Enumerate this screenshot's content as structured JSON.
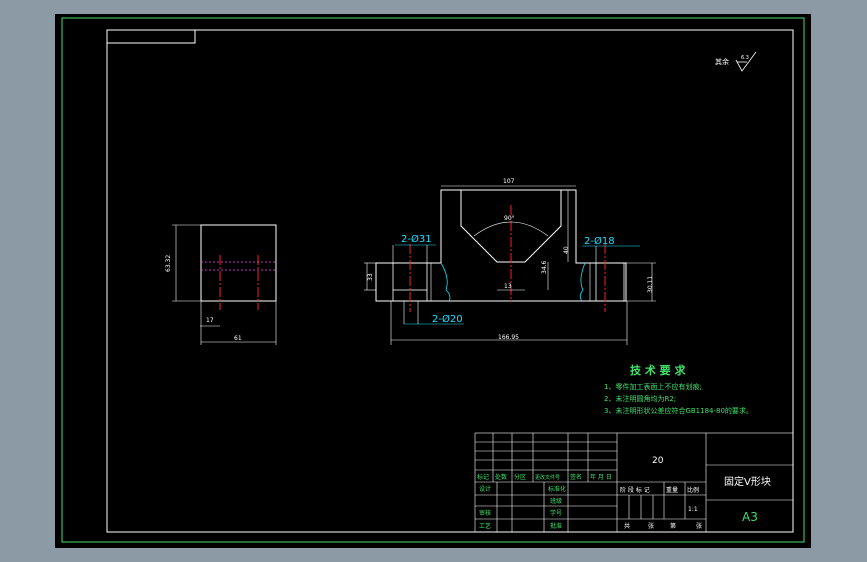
{
  "colors": {
    "background": "#000000",
    "frame": "#ffffff",
    "outer_frame": "#3fe06a",
    "geometry": "#ffffff",
    "dimension": "#00ff66",
    "centerline": "#ff2020",
    "hidden": "#ff44ff",
    "cyan": "#18e0ff"
  },
  "surface_roughness": {
    "label": "其余",
    "value": "6.3"
  },
  "left_view": {
    "dim_height": "63.32",
    "dim_width": "61",
    "dim_small": "17"
  },
  "front_view": {
    "dim_top": "107",
    "dim_angle": "90°",
    "dim_left_hole": "2-Ø31",
    "dim_right_hole": "2-Ø18",
    "dim_bottom_hole": "2-Ø20",
    "dim_overall": "166.95",
    "dim_left_height": "33",
    "dim_right_height": "30.11",
    "dim_v_depth": "40",
    "dim_v_inner": "34.6",
    "dim_v_bottom": "13"
  },
  "tech_requirements": {
    "title": "技 术 要 求",
    "items": [
      "1、零件加工表面上不应有划痕;",
      "2、未注明圆角均为R2;",
      "3、未注明形状公差应符合GB1184-80的要求。"
    ]
  },
  "title_block": {
    "part_number": "20",
    "part_name": "固定V形块",
    "sheet_size": "A3",
    "rev_headers": [
      "标记",
      "处数",
      "分区",
      "更改文件号",
      "签名",
      "年 月 日"
    ],
    "row_labels": [
      "设计",
      "审核",
      "工艺"
    ],
    "mid_labels": [
      "标准化",
      "班级",
      "学号",
      "批准"
    ],
    "stage_headers": [
      "阶 段 标 记",
      "重量",
      "比例"
    ],
    "scale": "1:1",
    "sheet_info": [
      "共",
      "张",
      "第",
      "张"
    ]
  }
}
